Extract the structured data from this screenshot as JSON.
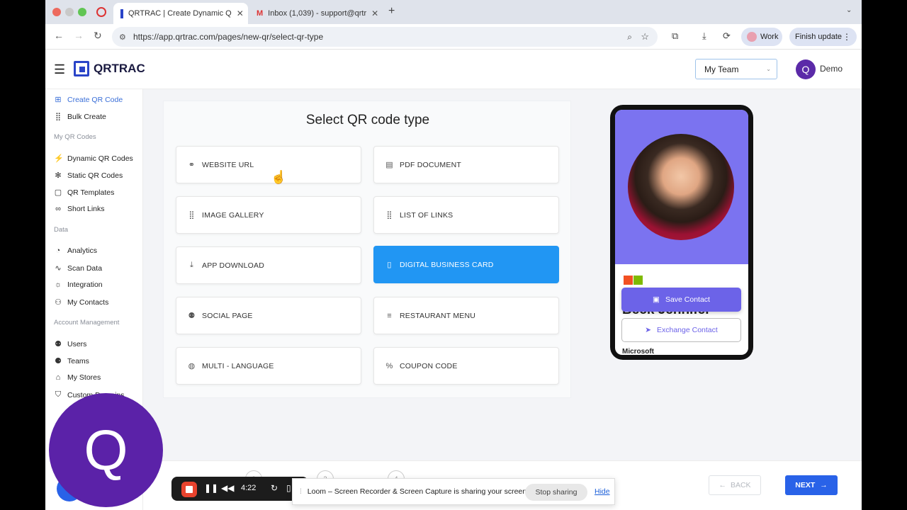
{
  "browser": {
    "tabs": [
      {
        "label": "QRTRAC | Create Dynamic Q"
      },
      {
        "label": "Inbox (1,039) - support@qrtr"
      }
    ],
    "url": "https://app.qrtrac.com/pages/new-qr/select-qr-type",
    "profile_label": "Work",
    "update_label": "Finish update"
  },
  "header": {
    "logo_text": "QRTRAC",
    "team_select": "My Team",
    "avatar_initial": "Q",
    "user_name": "Demo"
  },
  "sidebar": {
    "items_top": [
      {
        "label": "Create QR Code",
        "icon": "plus-square-icon"
      },
      {
        "label": "Bulk Create",
        "icon": "grid-icon"
      }
    ],
    "section_qr": "My QR Codes",
    "items_qr": [
      {
        "label": "Dynamic QR Codes",
        "icon": "bolt-icon"
      },
      {
        "label": "Static QR Codes",
        "icon": "snowflake-icon"
      },
      {
        "label": "QR Templates",
        "icon": "document-icon"
      },
      {
        "label": "Short Links",
        "icon": "link-icon"
      }
    ],
    "section_data": "Data",
    "items_data": [
      {
        "label": "Analytics",
        "icon": "pie-chart-icon"
      },
      {
        "label": "Scan Data",
        "icon": "activity-icon"
      },
      {
        "label": "Integration",
        "icon": "sun-icon"
      },
      {
        "label": "My Contacts",
        "icon": "user-icon"
      }
    ],
    "section_account": "Account Management",
    "items_account": [
      {
        "label": "Users",
        "icon": "users-icon"
      },
      {
        "label": "Teams",
        "icon": "team-icon"
      },
      {
        "label": "My Stores",
        "icon": "store-icon"
      },
      {
        "label": "Custom Domains",
        "icon": "shield-icon"
      }
    ]
  },
  "main": {
    "title": "Select QR code type",
    "types": [
      {
        "label": "WEBSITE URL",
        "icon": "link-icon"
      },
      {
        "label": "PDF DOCUMENT",
        "icon": "document-icon"
      },
      {
        "label": "IMAGE GALLERY",
        "icon": "grid-icon"
      },
      {
        "label": "LIST OF LINKS",
        "icon": "grid-icon"
      },
      {
        "label": "APP DOWNLOAD",
        "icon": "download-icon"
      },
      {
        "label": "DIGITAL BUSINESS CARD",
        "icon": "card-icon",
        "selected": true
      },
      {
        "label": "SOCIAL PAGE",
        "icon": "users-icon"
      },
      {
        "label": "RESTAURANT MENU",
        "icon": "menu-icon"
      },
      {
        "label": "MULTI - LANGUAGE",
        "icon": "globe-icon"
      },
      {
        "label": "COUPON CODE",
        "icon": "percent-icon"
      }
    ]
  },
  "preview": {
    "name": "Beck Jennifer",
    "save_label": "Save Contact",
    "exchange_label": "Exchange Contact",
    "company": "Microsoft"
  },
  "footer": {
    "steps": [
      "2",
      "3",
      "4"
    ],
    "back_label": "BACK",
    "next_label": "NEXT"
  },
  "loom": {
    "timer": "4:22",
    "notice": "Loom – Screen Recorder & Screen Capture is sharing your screen.",
    "stop_label": "Stop sharing",
    "hide_label": "Hide"
  },
  "overlay": {
    "avatar_initial": "Q"
  },
  "colors": {
    "accent": "#2196f3",
    "primary": "#2962e8",
    "brand_purple": "#5b22a8",
    "card_purple": "#7b73f0"
  }
}
